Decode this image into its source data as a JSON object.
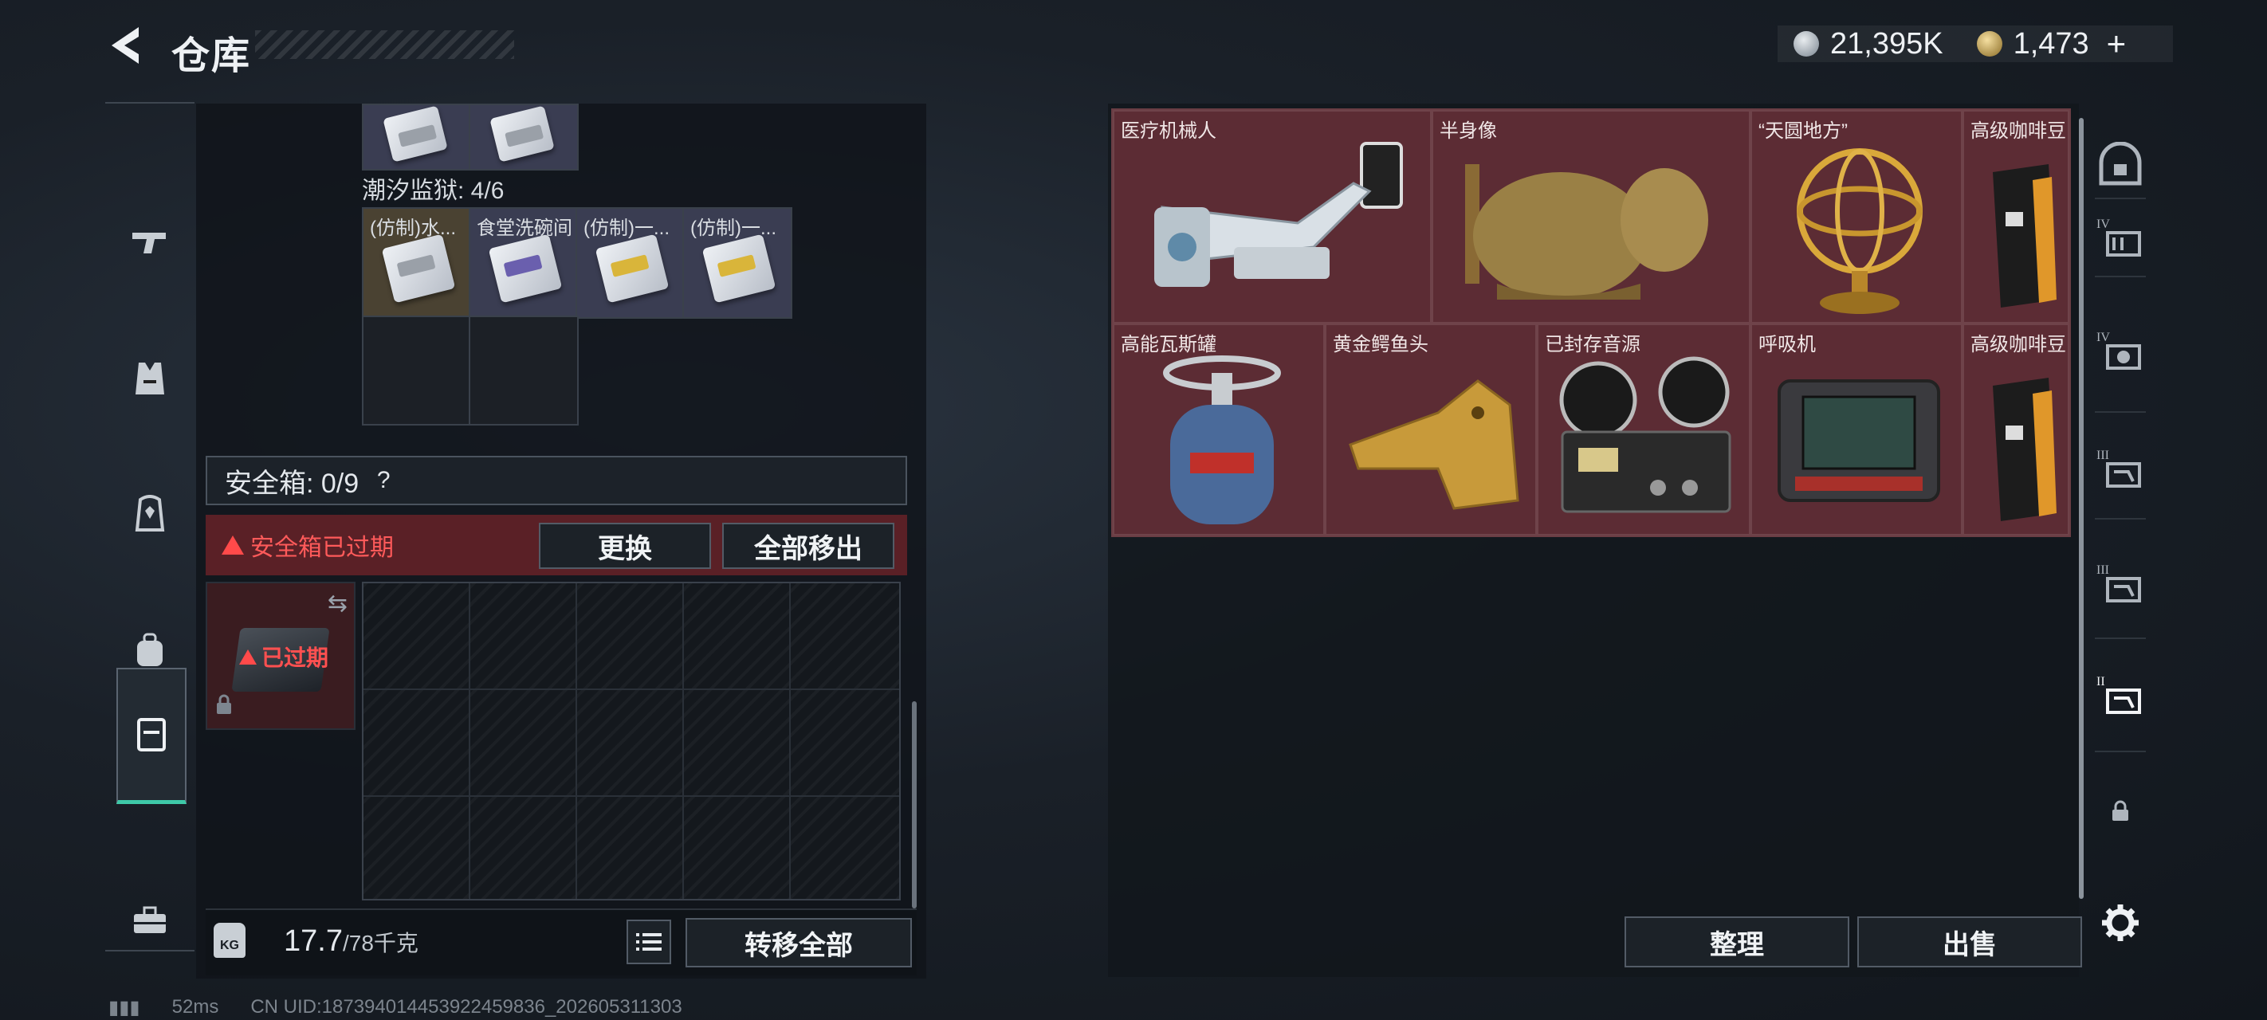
{
  "header": {
    "title": "仓库"
  },
  "currency": [
    {
      "icon": "silver-coin-icon",
      "value": "21,395K"
    },
    {
      "icon": "gold-coin-icon",
      "value": "1,473"
    }
  ],
  "currency_add": "+",
  "left_nav": [
    {
      "icon": "pistol-icon"
    },
    {
      "icon": "vest-icon"
    },
    {
      "icon": "chest-rig-icon"
    },
    {
      "icon": "backpack-icon"
    },
    {
      "icon": "safebox-icon",
      "active": true
    },
    {
      "icon": "toolbox-icon"
    }
  ],
  "inventory": {
    "section_label": "潮汐监狱: 4/6",
    "items": [
      {
        "label": "(仿制)水...",
        "tint": "gold",
        "card": "gray"
      },
      {
        "label": "食堂洗碗间",
        "tint": "purple",
        "card": "purple"
      },
      {
        "label": "(仿制)一...",
        "tint": "purple",
        "card": "yellow"
      },
      {
        "label": "(仿制)一...",
        "tint": "purple",
        "card": "yellow"
      }
    ]
  },
  "safebox": {
    "label": "安全箱: 0/9",
    "help": "?",
    "expired_msg": "安全箱已过期",
    "replace_label": "更换",
    "move_all_label": "全部移出",
    "thumb_status": "已过期"
  },
  "weight": {
    "current": "17.7",
    "capacity": "/78千克",
    "kg_label": "KG"
  },
  "transfer_all_label": "转移全部",
  "loot": [
    {
      "label": "医疗机械人",
      "art": "robot-arm"
    },
    {
      "label": "半身像",
      "art": "bust"
    },
    {
      "label": "“天圆地方”",
      "art": "armillary"
    },
    {
      "label": "高级咖啡豆",
      "art": "coffee"
    },
    {
      "label": "高能瓦斯罐",
      "art": "gas-tank"
    },
    {
      "label": "黄金鳄鱼头",
      "art": "croc-head"
    },
    {
      "label": "已封存音源",
      "art": "tape-recorder"
    },
    {
      "label": "呼吸机",
      "art": "ventilator"
    },
    {
      "label": "高级咖啡豆",
      "art": "coffee"
    }
  ],
  "right_buttons": {
    "sort_label": "整理",
    "sell_label": "出售"
  },
  "right_nav": [
    {
      "icon": "home-safe-icon",
      "tier": ""
    },
    {
      "icon": "container-icon",
      "tier": "IV"
    },
    {
      "icon": "container-icon",
      "tier": "IV"
    },
    {
      "icon": "container-icon",
      "tier": "III"
    },
    {
      "icon": "container-icon",
      "tier": "III"
    },
    {
      "icon": "container-icon",
      "tier": "II"
    },
    {
      "icon": "lock-icon",
      "tier": ""
    },
    {
      "icon": "gear-icon",
      "tier": ""
    }
  ],
  "status_bar": {
    "ping": "52ms",
    "uid": "CN UID:187394014453922459836_202605311303"
  },
  "colors": {
    "accent": "#3ec9a8",
    "warning": "#ff4a4a",
    "loot_bg": "#4e2a30"
  }
}
